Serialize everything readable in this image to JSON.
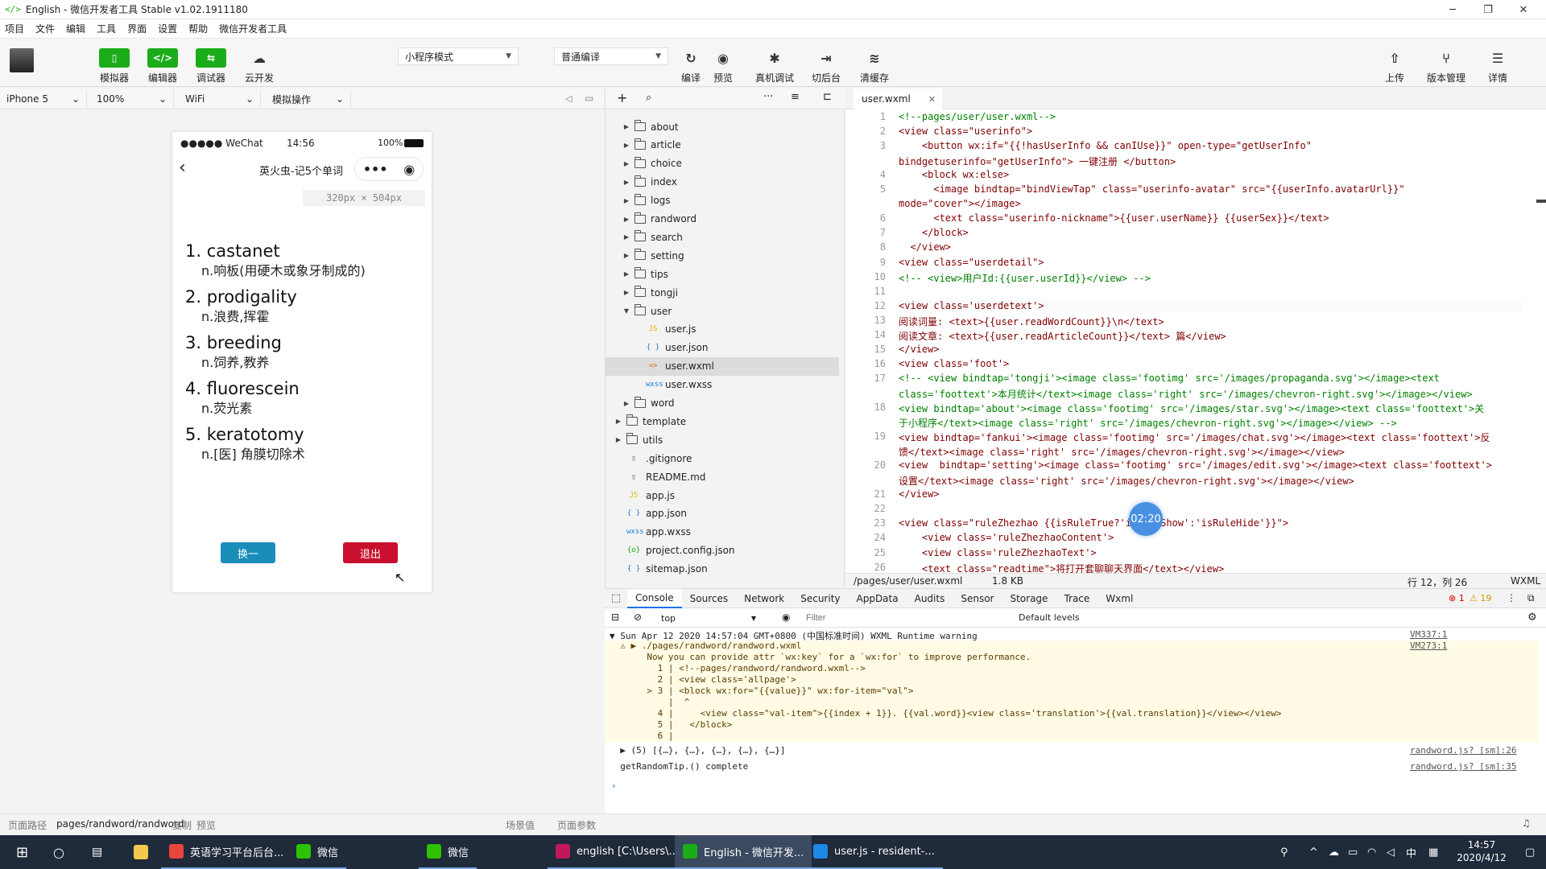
{
  "window": {
    "title": "English - 微信开发者工具 Stable v1.02.1911180",
    "logo": "</>"
  },
  "menu": [
    "项目",
    "文件",
    "编辑",
    "工具",
    "界面",
    "设置",
    "帮助",
    "微信开发者工具"
  ],
  "toolbar": {
    "simulator": "模拟器",
    "editor": "编辑器",
    "debugger": "调试器",
    "cloud": "云开发",
    "mode": "小程序模式",
    "compile_mode": "普通编译",
    "compile": "编译",
    "preview": "预览",
    "realdebug": "真机调试",
    "background": "切后台",
    "clearcache": "清缓存",
    "upload": "上传",
    "version": "版本管理",
    "details": "详情"
  },
  "device": {
    "model": "iPhone 5",
    "zoom": "100%",
    "network": "WiFi",
    "sim_ops": "模拟操作"
  },
  "phone": {
    "carrier": "●●●●● WeChat",
    "time": "14:56",
    "battery": "100%",
    "nav_title": "英火虫-记5个单词",
    "size_hint": "320px × 504px",
    "words": [
      {
        "word": "1. castanet",
        "trans": "n.响板(用硬木或象牙制成的)"
      },
      {
        "word": "2. prodigality",
        "trans": "n.浪费,挥霍"
      },
      {
        "word": "3. breeding",
        "trans": "n.饲养,教养"
      },
      {
        "word": "4. fluorescein",
        "trans": "n.荧光素"
      },
      {
        "word": "5. keratotomy",
        "trans": "n.[医] 角膜切除术"
      }
    ],
    "btn_change": "换一",
    "btn_exit": "退出"
  },
  "filetree": {
    "nodes": [
      {
        "label": "about",
        "type": "folder",
        "depth": 1,
        "arrow": "▶"
      },
      {
        "label": "article",
        "type": "folder",
        "depth": 1,
        "arrow": "▶"
      },
      {
        "label": "choice",
        "type": "folder",
        "depth": 1,
        "arrow": "▶"
      },
      {
        "label": "index",
        "type": "folder",
        "depth": 1,
        "arrow": "▶"
      },
      {
        "label": "logs",
        "type": "folder",
        "depth": 1,
        "arrow": "▶"
      },
      {
        "label": "randword",
        "type": "folder",
        "depth": 1,
        "arrow": "▶"
      },
      {
        "label": "search",
        "type": "folder",
        "depth": 1,
        "arrow": "▶"
      },
      {
        "label": "setting",
        "type": "folder",
        "depth": 1,
        "arrow": "▶"
      },
      {
        "label": "tips",
        "type": "folder",
        "depth": 1,
        "arrow": "▶"
      },
      {
        "label": "tongji",
        "type": "folder",
        "depth": 1,
        "arrow": "▶"
      },
      {
        "label": "user",
        "type": "folder",
        "depth": 1,
        "arrow": "▼"
      },
      {
        "label": "user.js",
        "type": "JS",
        "depth": 2,
        "arrow": ""
      },
      {
        "label": "user.json",
        "type": "{ }",
        "depth": 2,
        "arrow": ""
      },
      {
        "label": "user.wxml",
        "type": "<>",
        "depth": 2,
        "arrow": "",
        "active": true
      },
      {
        "label": "user.wxss",
        "type": "wxss",
        "depth": 2,
        "arrow": ""
      },
      {
        "label": "word",
        "type": "folder",
        "depth": 1,
        "arrow": "▶"
      },
      {
        "label": "template",
        "type": "folder",
        "depth": 0,
        "arrow": "▶"
      },
      {
        "label": "utils",
        "type": "folder",
        "depth": 0,
        "arrow": "▶"
      },
      {
        "label": ".gitignore",
        "type": "file",
        "depth": 0,
        "arrow": ""
      },
      {
        "label": "README.md",
        "type": "file",
        "depth": 0,
        "arrow": ""
      },
      {
        "label": "app.js",
        "type": "JS",
        "depth": 0,
        "arrow": ""
      },
      {
        "label": "app.json",
        "type": "{ }",
        "depth": 0,
        "arrow": ""
      },
      {
        "label": "app.wxss",
        "type": "wxss",
        "depth": 0,
        "arrow": ""
      },
      {
        "label": "project.config.json",
        "type": "{o}",
        "depth": 0,
        "arrow": ""
      },
      {
        "label": "sitemap.json",
        "type": "{ }",
        "depth": 0,
        "arrow": ""
      }
    ],
    "colors": {
      "JS": "#d9b800",
      "{ }": "#1b7bd8",
      "<>": "#e06c00",
      "wxss": "#1b7bd8",
      "{o}": "#1aad19",
      "file": "#555"
    }
  },
  "editor": {
    "tab": "user.wxml",
    "code": [
      {
        "n": "1",
        "t": "<!--pages/user/user.wxml-->",
        "c": "cm"
      },
      {
        "n": "2",
        "t": "<view class=\"userinfo\">",
        "c": "tg"
      },
      {
        "n": "3",
        "t": "    <button wx:if=\"{{!hasUserInfo && canIUse}}\" open-type=\"getUserInfo\"",
        "c": "tg"
      },
      {
        "n": "",
        "t": "bindgetuserinfo=\"getUserInfo\"> 一键注册 </button>",
        "c": "tg"
      },
      {
        "n": "4",
        "t": "    <block wx:else>",
        "c": "tg"
      },
      {
        "n": "5",
        "t": "      <image bindtap=\"bindViewTap\" class=\"userinfo-avatar\" src=\"{{userInfo.avatarUrl}}\"",
        "c": "tg"
      },
      {
        "n": "",
        "t": "mode=\"cover\"></image>",
        "c": "tg"
      },
      {
        "n": "6",
        "t": "      <text class=\"userinfo-nickname\">{{user.userName}} {{userSex}}</text>",
        "c": "tg"
      },
      {
        "n": "7",
        "t": "    </block>",
        "c": "tg"
      },
      {
        "n": "8",
        "t": "  </view>",
        "c": "tg"
      },
      {
        "n": "9",
        "t": "<view class=\"userdetail\">",
        "c": "tg"
      },
      {
        "n": "10",
        "t": "<!-- <view>用户Id:{{user.userId}}</view> -->",
        "c": "cm"
      },
      {
        "n": "11",
        "t": "",
        "c": "tg"
      },
      {
        "n": "12",
        "t": "<view class='userdetext'>",
        "c": "tg"
      },
      {
        "n": "13",
        "t": "阅读词量: <text>{{user.readWordCount}}\\n</text>",
        "c": "tg"
      },
      {
        "n": "14",
        "t": "阅读文章: <text>{{user.readArticleCount}}</text> 篇</view>",
        "c": "tg"
      },
      {
        "n": "15",
        "t": "</view>",
        "c": "tg"
      },
      {
        "n": "16",
        "t": "<view class='foot'>",
        "c": "tg"
      },
      {
        "n": "17",
        "t": "<!-- <view bindtap='tongji'><image class='footimg' src='/images/propaganda.svg'></image><text",
        "c": "cm"
      },
      {
        "n": "",
        "t": "class='foottext'>本月统计</text><image class='right' src='/images/chevron-right.svg'></image></view>",
        "c": "cm"
      },
      {
        "n": "18",
        "t": "<view bindtap='about'><image class='footimg' src='/images/star.svg'></image><text class='foottext'>关",
        "c": "cm"
      },
      {
        "n": "",
        "t": "于小程序</text><image class='right' src='/images/chevron-right.svg'></image></view> -->",
        "c": "cm"
      },
      {
        "n": "19",
        "t": "<view bindtap='fankui'><image class='footimg' src='/images/chat.svg'></image><text class='foottext'>反",
        "c": "tg"
      },
      {
        "n": "",
        "t": "馈</text><image class='right' src='/images/chevron-right.svg'></image></view>",
        "c": "tg"
      },
      {
        "n": "20",
        "t": "<view  bindtap='setting'><image class='footimg' src='/images/edit.svg'></image><text class='foottext'>",
        "c": "tg"
      },
      {
        "n": "",
        "t": "设置</text><image class='right' src='/images/chevron-right.svg'></image></view>",
        "c": "tg"
      },
      {
        "n": "21",
        "t": "</view>",
        "c": "tg"
      },
      {
        "n": "22",
        "t": "",
        "c": "tg"
      },
      {
        "n": "23",
        "t": "<view class=\"ruleZhezhao {{isRuleTrue?'isRuleShow':'isRuleHide'}}\">",
        "c": "tg"
      },
      {
        "n": "24",
        "t": "    <view class='ruleZhezhaoContent'>",
        "c": "tg"
      },
      {
        "n": "25",
        "t": "    <view class='ruleZhezhaoText'>",
        "c": "tg"
      },
      {
        "n": "26",
        "t": "    <text class=\"readtime\">将打开套聊聊天界面</text></view>",
        "c": "tg"
      }
    ],
    "status_path": "/pages/user/user.wxml",
    "status_size": "1.8 KB",
    "status_pos": "行 12，列 26",
    "status_lang": "WXML"
  },
  "timer": "02:20",
  "devtools": {
    "tabs": [
      "Console",
      "Sources",
      "Network",
      "Security",
      "AppData",
      "Audits",
      "Sensor",
      "Storage",
      "Trace",
      "Wxml"
    ],
    "errors": "1",
    "warnings": "19",
    "context": "top",
    "filter_placeholder": "Filter",
    "levels": "Default levels",
    "console": [
      {
        "t": "▼ Sun Apr 12 2020 14:57:04 GMT+0800 (中国标准时间) WXML Runtime warning",
        "r": "VM337:1",
        "w": false
      },
      {
        "t": "  ⚠ ▶ ./pages/randword/randword.wxml",
        "r": "VM273:1",
        "w": true
      },
      {
        "t": "       Now you can provide attr `wx:key` for a `wx:for` to improve performance.",
        "r": "",
        "w": true
      },
      {
        "t": "         1 | <!--pages/randword/randword.wxml-->",
        "r": "",
        "w": true
      },
      {
        "t": "         2 | <view class='allpage'>",
        "r": "",
        "w": true
      },
      {
        "t": "       > 3 | <block wx:for=\"{{value}}\" wx:for-item=\"val\">",
        "r": "",
        "w": true
      },
      {
        "t": "           |  ^",
        "r": "",
        "w": true
      },
      {
        "t": "         4 |     <view class=\"val-item\">{{index + 1}}. {{val.word}}<view class='translation'>{{val.translation}}</view></view>",
        "r": "",
        "w": true
      },
      {
        "t": "         5 |   </block>",
        "r": "",
        "w": true
      },
      {
        "t": "         6 |",
        "r": "",
        "w": true
      },
      {
        "t": "  ▶ (5) [{…}, {…}, {…}, {…}, {…}]",
        "r": "randword.js? [sm]:26",
        "w": false
      },
      {
        "t": "  getRandomTip.() complete",
        "r": "randword.js? [sm]:35",
        "w": false
      }
    ]
  },
  "pathbar": {
    "label": "页面路径",
    "path": "pages/randword/randword",
    "copy": "复制",
    "preview": "预览",
    "scene": "场景值",
    "params": "页面参数"
  },
  "taskbar": {
    "apps": [
      {
        "label": "英语学习平台后台...",
        "color": "#e8453c"
      },
      {
        "label": "微信",
        "color": "#2dc100"
      },
      {
        "label": "微信",
        "color": "#2dc100"
      },
      {
        "label": "english [C:\\Users\\...",
        "color": "#c2185b"
      },
      {
        "label": "English - 微信开发...",
        "color": "#1aad19"
      },
      {
        "label": "user.js - resident-...",
        "color": "#1e88e5"
      }
    ],
    "ime": "中",
    "time": "14:57",
    "date": "2020/4/12"
  }
}
